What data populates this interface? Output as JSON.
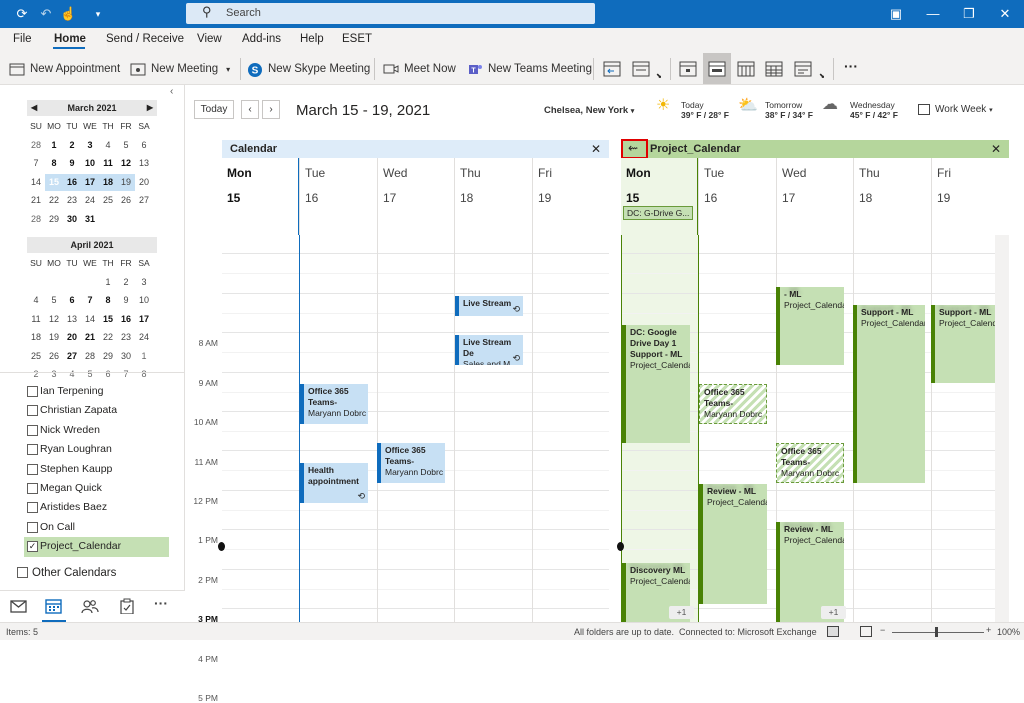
{
  "titlebar": {
    "search_placeholder": "Search"
  },
  "menus": [
    "File",
    "Home",
    "Send / Receive",
    "View",
    "Add-ins",
    "Help",
    "ESET"
  ],
  "ribbon": {
    "new_appointment": "New Appointment",
    "new_meeting": "New Meeting",
    "new_skype_meeting": "New Skype Meeting",
    "meet_now": "Meet Now",
    "new_teams_meeting": "New Teams Meeting",
    "more": "···"
  },
  "mini_calendars": [
    {
      "title": "March 2021",
      "headers": [
        "SU",
        "MO",
        "TU",
        "WE",
        "TH",
        "FR",
        "SA"
      ],
      "rows": [
        [
          "28",
          "1",
          "2",
          "3",
          "4",
          "5",
          "6"
        ],
        [
          "7",
          "8",
          "9",
          "10",
          "11",
          "12",
          "13"
        ],
        [
          "14",
          "15",
          "16",
          "17",
          "18",
          "19",
          "20"
        ],
        [
          "21",
          "22",
          "23",
          "24",
          "25",
          "26",
          "27"
        ],
        [
          "28",
          "29",
          "30",
          "31",
          "",
          "",
          ""
        ]
      ]
    },
    {
      "title": "April 2021",
      "headers": [
        "SU",
        "MO",
        "TU",
        "WE",
        "TH",
        "FR",
        "SA"
      ],
      "rows": [
        [
          "",
          "",
          "",
          "",
          "1",
          "2",
          "3"
        ],
        [
          "4",
          "5",
          "6",
          "7",
          "8",
          "9",
          "10"
        ],
        [
          "11",
          "12",
          "13",
          "14",
          "15",
          "16",
          "17"
        ],
        [
          "18",
          "19",
          "20",
          "21",
          "22",
          "23",
          "24"
        ],
        [
          "25",
          "26",
          "27",
          "28",
          "29",
          "30",
          "1"
        ],
        [
          "2",
          "3",
          "4",
          "5",
          "6",
          "7",
          "8"
        ]
      ]
    }
  ],
  "calendar_list": [
    "Ian Terpening",
    "Christian Zapata",
    "Nick Wreden",
    "Ryan Loughran",
    "Stephen Kaupp",
    "Megan Quick",
    "Aristides Baez",
    "On Call",
    "Project_Calendar"
  ],
  "other_calendars": "Other Calendars",
  "toolbar": {
    "today": "Today",
    "date_range": "March 15 - 19, 2021",
    "location": "Chelsea, New York",
    "work_week": "Work Week"
  },
  "weather": [
    {
      "label": "Today",
      "temp": "39° F / 28° F"
    },
    {
      "label": "Tomorrow",
      "temp": "38° F / 34° F"
    },
    {
      "label": "Wednesday",
      "temp": "45° F / 42° F"
    }
  ],
  "panes": [
    {
      "title": "Calendar",
      "color": "#deecf9"
    },
    {
      "title": "Project_Calendar",
      "color": "#b5d69c"
    }
  ],
  "days": [
    {
      "name": "Mon",
      "num": "15"
    },
    {
      "name": "Tue",
      "num": "16"
    },
    {
      "name": "Wed",
      "num": "17"
    },
    {
      "name": "Thu",
      "num": "18"
    },
    {
      "name": "Fri",
      "num": "19"
    }
  ],
  "times": [
    "8 AM",
    "9 AM",
    "10 AM",
    "11 AM",
    "12 PM",
    "1 PM",
    "2 PM",
    "3 PM",
    "4 PM",
    "5 PM"
  ],
  "events_left": [
    {
      "title": "Live Stream",
      "sub": ""
    },
    {
      "title": "Live Stream De",
      "sub": "Sales and M"
    },
    {
      "title": "Office 365 Teams-",
      "sub": "Maryann Dobrc"
    },
    {
      "title": "Health appointment",
      "sub": ""
    },
    {
      "title": "Office 365 Teams-",
      "sub": "Maryann Dobrc"
    }
  ],
  "events_right": {
    "allday": "DC: G-Drive G...",
    "dc_google": {
      "title": "DC: Google Drive Day 1 Support - ML",
      "sub": "Project_Calendar"
    },
    "o365_tue": {
      "title": "Office 365 Teams-",
      "sub": "Maryann Dobrc"
    },
    "wed_ml": {
      "title": "- ML",
      "sub": "Project_Calendar"
    },
    "o365_wed": {
      "title": "Office 365 Teams-",
      "sub": "Maryann Dobrc"
    },
    "thu": {
      "title": "Support - ML",
      "sub": "Project_Calendar"
    },
    "fri": {
      "title": "Support - ML",
      "sub": "Project_Calendar"
    },
    "review_tue": {
      "title": "Review - ML",
      "sub": "Project_Calendar"
    },
    "review_wed": {
      "title": "Review - ML",
      "sub": "Project_Calendar"
    },
    "discovery": {
      "title": "Discovery ML",
      "sub": "Project_Calendar"
    },
    "more1": "+1",
    "more2": "+1"
  },
  "status": {
    "items": "Items: 5",
    "folders": "All folders are up to date.",
    "connected": "Connected to: Microsoft Exchange",
    "zoom": "100%"
  }
}
